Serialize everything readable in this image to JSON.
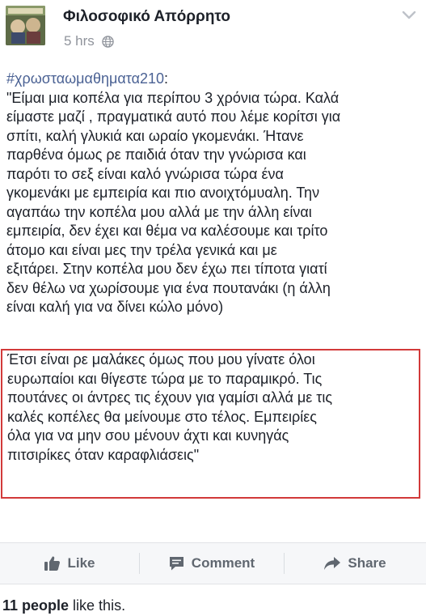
{
  "header": {
    "page_name": "Φιλοσοφικό Απόρρητο",
    "timestamp": "5 hrs",
    "privacy_icon": "globe-icon",
    "menu_icon": "chevron-down-icon"
  },
  "post": {
    "hashtag": "#χρωσταωμαθηματα210",
    "hashtag_suffix": ":",
    "lines": [
      "\"Είμαι μια κοπέλα για περίπου 3 χρόνια τώρα. Καλά",
      "είμαστε μαζί , πραγματικά αυτό που λέμε κορίτσι για",
      "σπίτι, καλή γλυκιά και ωραίο γκομενάκι. Ήτανε",
      "παρθένα όμως ρε παιδιά όταν την γνώρισα και",
      "παρότι το σεξ είναι καλό γνώρισα τώρα ένα",
      "γκομενάκι με εμπειρία και πιο ανοιχτόμυαλη. Την",
      "αγαπάω την κοπέλα μου αλλά με την άλλη είναι",
      "εμπειρία, δεν έχει και θέμα να καλέσουμε και τρίτο",
      "άτομο και είναι μες την τρέλα γενικά και με",
      "εξιτάρει. Στην κοπέλα μου δεν έχω πει τίποτα γιατί",
      "δεν θέλω να χωρίσουμε για ένα πουτανάκι (η άλλη",
      "είναι καλή για να δίνει κώλο μόνο)"
    ],
    "highlighted_lines": [
      "Έτσι είναι ρε μαλάκες όμως που μου γίνατε όλοι",
      "ευρωπαίοι και θίγεστε τώρα με το παραμικρό. Τις",
      "πουτάνες οι άντρες τις έχουν για γαμίσι αλλά με τις",
      "καλές κοπέλες θα μείνουμε στο τέλος. Εμπειρίες",
      "όλα για να μην σου μένουν άχτι και κυνηγάς",
      "πιτσιρίκες όταν καραφλιάσεις\""
    ],
    "highlight_color": "#d23a3a",
    "hashtag_color": "#4b6294"
  },
  "actions": {
    "like_label": "Like",
    "comment_label": "Comment",
    "share_label": "Share",
    "like_icon": "thumbs-up-icon",
    "comment_icon": "comment-bubble-icon",
    "share_icon": "share-arrow-icon"
  },
  "likes": {
    "count_text": "11 people",
    "suffix_text": " like this."
  }
}
